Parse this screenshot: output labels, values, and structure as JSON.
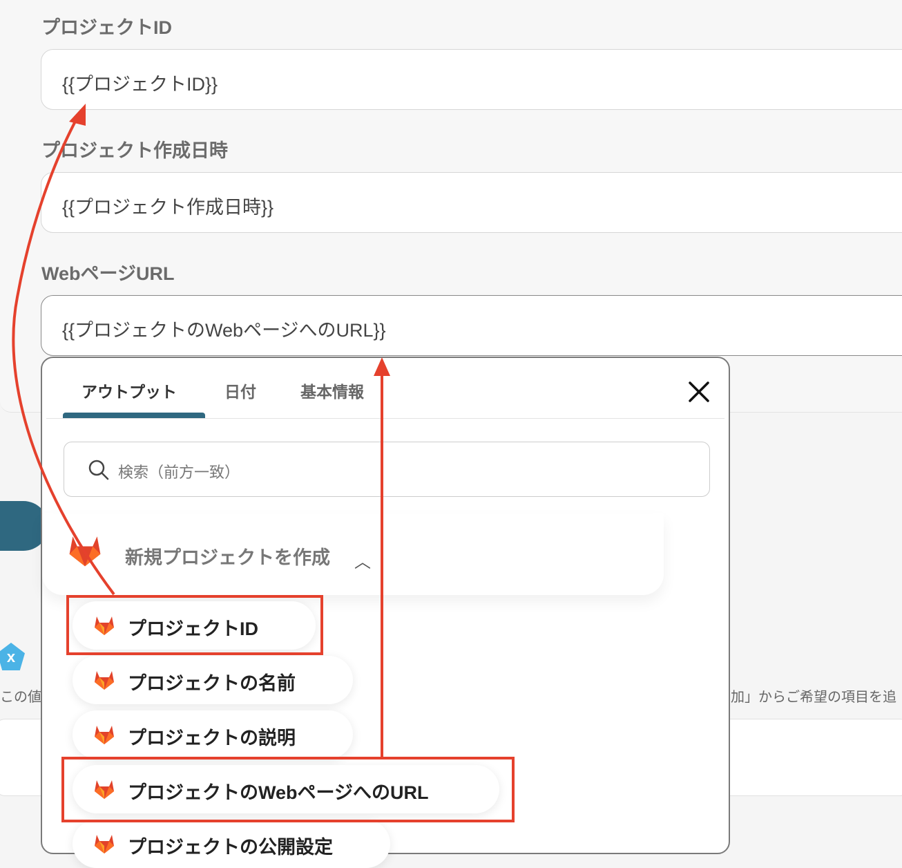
{
  "form": {
    "fields": [
      {
        "label": "プロジェクトID",
        "value": "{{プロジェクトID}}"
      },
      {
        "label": "プロジェクト作成日時",
        "value": "{{プロジェクト作成日時}}"
      },
      {
        "label": "WebページURL",
        "value": "{{プロジェクトのWebページへのURL}}"
      }
    ]
  },
  "background": {
    "hint_left": "この値",
    "hint_right": "加」からご希望の項目を追",
    "x_icon_label": "x"
  },
  "dropdown": {
    "tabs": [
      {
        "label": "アウトプット",
        "active": true
      },
      {
        "label": "日付",
        "active": false
      },
      {
        "label": "基本情報",
        "active": false
      }
    ],
    "search_placeholder": "検索（前方一致）",
    "group_title": "新規プロジェクトを作成",
    "items": [
      {
        "label": "プロジェクトID",
        "highlighted": true
      },
      {
        "label": "プロジェクトの名前",
        "highlighted": false
      },
      {
        "label": "プロジェクトの説明",
        "highlighted": false
      },
      {
        "label": "プロジェクトのWebページへのURL",
        "highlighted": true
      },
      {
        "label": "プロジェクトの公開設定",
        "highlighted": false
      }
    ]
  },
  "colors": {
    "accent": "#2f6880",
    "annotation": "#e5412d",
    "gitlab": "#e2432a"
  }
}
